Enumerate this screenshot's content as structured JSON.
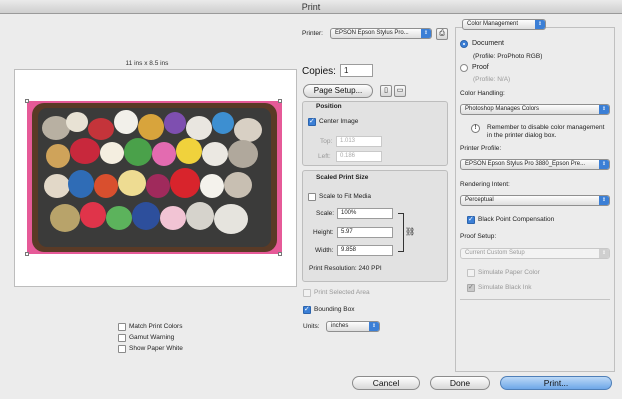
{
  "window": {
    "title": "Print"
  },
  "preview": {
    "size_caption": "11 ins x 8.5 ins"
  },
  "printer": {
    "label": "Printer:",
    "value": "EPSON Epson Stylus Pro..."
  },
  "copies": {
    "label": "Copies:",
    "value": "1"
  },
  "page_setup": {
    "label": "Page Setup..."
  },
  "position": {
    "title": "Position",
    "center_image": {
      "label": "Center Image",
      "checked": true
    },
    "top": {
      "label": "Top:",
      "value": "1.013"
    },
    "left": {
      "label": "Left:",
      "value": "0.186"
    }
  },
  "scaled_print_size": {
    "title": "Scaled Print Size",
    "scale_to_fit": {
      "label": "Scale to Fit Media",
      "checked": false
    },
    "scale": {
      "label": "Scale:",
      "value": "100%"
    },
    "height": {
      "label": "Height:",
      "value": "5.97"
    },
    "width": {
      "label": "Width:",
      "value": "9.858"
    },
    "resolution": "Print Resolution: 240 PPI"
  },
  "print_selected_area": {
    "label": "Print Selected Area",
    "checked": false,
    "enabled": false
  },
  "bounding_box": {
    "label": "Bounding Box",
    "checked": true
  },
  "units": {
    "label": "Units:",
    "value": "inches"
  },
  "left_options": [
    {
      "label": "Match Print Colors",
      "checked": false
    },
    {
      "label": "Gamut Warning",
      "checked": false
    },
    {
      "label": "Show Paper White",
      "checked": false
    }
  ],
  "color_management": {
    "section_popup": "Color Management",
    "document": {
      "label": "Document",
      "profile": "(Profile: ProPhoto RGB)",
      "selected": true
    },
    "proof": {
      "label": "Proof",
      "profile": "(Profile: N/A)",
      "selected": false
    },
    "color_handling_label": "Color Handling:",
    "color_handling": "Photoshop Manages Colors",
    "note_line1": "Remember to disable color management",
    "note_line2": "in the printer dialog box.",
    "printer_profile_label": "Printer Profile:",
    "printer_profile": "EPSON Epson Stylus Pro 3880_Epson Pre...",
    "rendering_intent_label": "Rendering Intent:",
    "rendering_intent": "Perceptual",
    "black_point": {
      "label": "Black Point Compensation",
      "checked": true
    },
    "proof_setup_label": "Proof Setup:",
    "proof_setup": "Current Custom Setup",
    "simulate_paper": {
      "label": "Simulate Paper Color",
      "checked": false
    },
    "simulate_black": {
      "label": "Simulate Black Ink",
      "checked": true
    }
  },
  "buttons": {
    "cancel": "Cancel",
    "done": "Done",
    "print": "Print..."
  },
  "colors": {
    "accent": "#3b7fd6",
    "pink_background": "#e65a98"
  },
  "icons": {
    "printer_settings": "printer-settings-icon",
    "portrait": "portrait-orientation-icon",
    "landscape": "landscape-orientation-icon",
    "link": "link-icon",
    "info": "info-icon"
  }
}
